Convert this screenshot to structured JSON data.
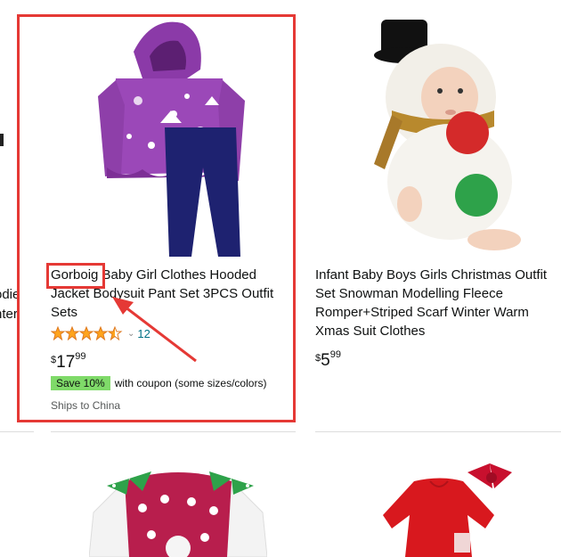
{
  "products": [
    {
      "brand": "Gorboig",
      "title_rest": " Baby Girl Clothes Hooded Jacket Bodysuit Pant Set 3PCS Outfit Sets",
      "rating_count": "12",
      "rating_stars": 4.5,
      "price_symbol": "$",
      "price_whole": "17",
      "price_fraction": "99",
      "badge": "Save 10%",
      "coupon_text": "with coupon (some sizes/colors)",
      "shipping": "Ships to China"
    },
    {
      "title": "Infant Baby Boys Girls Christmas Outfit Set Snowman Modelling Fleece Romper+Striped Scarf Winter Warm Xmas Suit Clothes",
      "price_symbol": "$",
      "price_whole": "5",
      "price_fraction": "99"
    }
  ],
  "left_edge": {
    "line1": "odie",
    "line2": "nter"
  },
  "colors": {
    "highlight": "#e53935",
    "badge": "#7fda69",
    "star": "#ffa41c",
    "link": "#007185"
  }
}
